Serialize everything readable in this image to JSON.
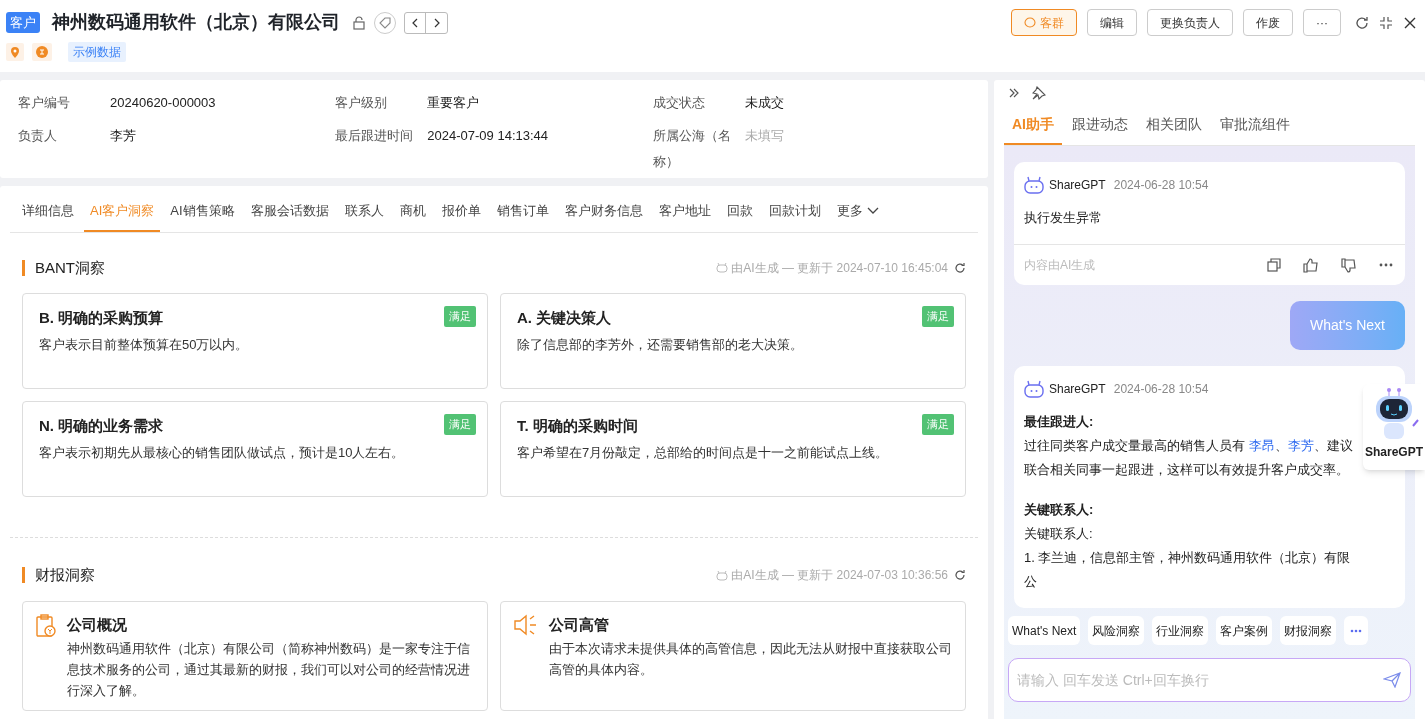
{
  "header": {
    "tag": "客户",
    "title": "神州数码通用软件（北京）有限公司",
    "badge": "示例数据",
    "buttons": [
      {
        "label": "客群",
        "kind": "primary"
      },
      {
        "label": "编辑",
        "kind": "default"
      },
      {
        "label": "更换负责人",
        "kind": "default"
      },
      {
        "label": "作废",
        "kind": "default"
      },
      {
        "label": "···",
        "kind": "default"
      }
    ]
  },
  "info": [
    {
      "label": "客户编号",
      "value": "20240620-000003",
      "empty": false
    },
    {
      "label": "客户级别",
      "value": "重要客户",
      "empty": false
    },
    {
      "label": "成交状态",
      "value": "未成交",
      "empty": false
    },
    {
      "label": "负责人",
      "value": "李芳",
      "empty": false
    },
    {
      "label": "最后跟进时间",
      "value": "2024-07-09 14:13:44",
      "empty": false
    },
    {
      "label": "所属公海（名称）",
      "value": "未填写",
      "empty": true
    }
  ],
  "tabs": [
    {
      "label": "详细信息",
      "selected": false
    },
    {
      "label": "AI客户洞察",
      "selected": true
    },
    {
      "label": "AI销售策略",
      "selected": false
    },
    {
      "label": "客服会话数据",
      "selected": false
    },
    {
      "label": "联系人",
      "selected": false
    },
    {
      "label": "商机",
      "selected": false
    },
    {
      "label": "报价单",
      "selected": false
    },
    {
      "label": "销售订单",
      "selected": false
    },
    {
      "label": "客户财务信息",
      "selected": false
    },
    {
      "label": "客户地址",
      "selected": false
    },
    {
      "label": "回款",
      "selected": false
    },
    {
      "label": "回款计划",
      "selected": false
    },
    {
      "label": "更多",
      "selected": false
    }
  ],
  "sections": [
    {
      "title": "BANT洞察",
      "meta": "由AI生成 — 更新于 2024-07-10 16:45:04",
      "cards": [
        {
          "title": "B. 明确的采购预算",
          "badge": "满足",
          "text": "客户表示目前整体预算在50万以内。"
        },
        {
          "title": "A. 关键决策人",
          "badge": "满足",
          "text": "除了信息部的李芳外，还需要销售部的老大决策。"
        },
        {
          "title": "N. 明确的业务需求",
          "badge": "满足",
          "text": "客户表示初期先从最核心的销售团队做试点，预计是10人左右。"
        },
        {
          "title": "T. 明确的采购时间",
          "badge": "满足",
          "text": "客户希望在7月份敲定，总部给的时间点是十一之前能试点上线。"
        }
      ]
    },
    {
      "title": "财报洞察",
      "meta": "由AI生成 — 更新于 2024-07-03 10:36:56",
      "cards": [
        {
          "title": "公司概况",
          "kind": "report",
          "text": "神州数码通用软件（北京）有限公司（简称神州数码）是一家专注于信息技术服务的公司，通过其最新的财报，我们可以对公司的经营情况进行深入了解。"
        },
        {
          "title": "公司高管",
          "kind": "speaker",
          "text": "由于本次请求未提供具体的高管信息，因此无法从财报中直接获取公司高管的具体内容。"
        }
      ]
    }
  ],
  "side": {
    "tabs": [
      {
        "label": "AI助手",
        "selected": true
      },
      {
        "label": "跟进动态",
        "selected": false
      },
      {
        "label": "相关团队",
        "selected": false
      },
      {
        "label": "审批流组件",
        "selected": false
      }
    ],
    "messages": [
      {
        "kind": "bot",
        "sender": "ShareGPT",
        "time": "2024-06-28 10:54",
        "blocks": [
          {
            "kind": "paragraph",
            "segments": [
              {
                "kind": "plain",
                "text": "执行发生异常"
              }
            ]
          }
        ],
        "footer": "内容由AI生成"
      },
      {
        "kind": "user",
        "text": "What's Next"
      },
      {
        "kind": "bot",
        "sender": "ShareGPT",
        "time": "2024-06-28 10:54",
        "blocks": [
          {
            "kind": "heading",
            "text": "最佳跟进人:"
          },
          {
            "kind": "paragraph",
            "segments": [
              {
                "kind": "plain",
                "text": "过往同类客户成交量最高的销售人员有 "
              },
              {
                "kind": "link",
                "text": "李昂"
              },
              {
                "kind": "plain",
                "text": "、"
              },
              {
                "kind": "link",
                "text": "李芳"
              },
              {
                "kind": "plain",
                "text": "、建议联合相关同事一起跟进，这样可以有效提升客户成交率。"
              }
            ]
          },
          {
            "kind": "heading",
            "text": "关键联系人:"
          },
          {
            "kind": "paragraph",
            "segments": [
              {
                "kind": "plain",
                "text": "关键联系人:"
              }
            ]
          },
          {
            "kind": "paragraph",
            "segments": [
              {
                "kind": "plain",
                "text": "1. 李兰迪，信息部主管，神州数码通用软件（北京）有限公"
              }
            ]
          }
        ]
      }
    ],
    "assistant_label": "ShareGPT",
    "chips": [
      "What's Next",
      "风险洞察",
      "行业洞察",
      "客户案例",
      "财报洞察"
    ],
    "input": {
      "placeholder": "请输入 回车发送 Ctrl+回车换行"
    }
  }
}
